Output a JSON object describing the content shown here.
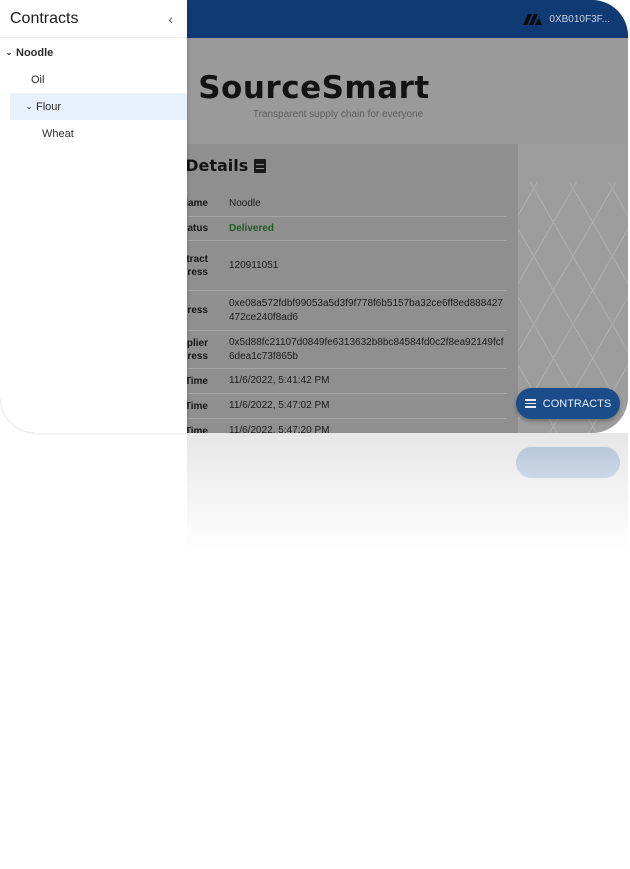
{
  "drawer": {
    "title": "Contracts",
    "tree": [
      {
        "label": "Noodle",
        "expanded": true
      },
      {
        "label": "Oil"
      },
      {
        "label": "Flour",
        "expanded": true,
        "selected": true
      },
      {
        "label": "Wheat"
      }
    ]
  },
  "header": {
    "wallet_address": "0XB010F3F...",
    "brand": "SourceSmart",
    "tagline": "Transparent supply chain for everyone"
  },
  "details": {
    "title_visible": "t Details",
    "rows": [
      {
        "key": "lame",
        "value": "Noodle"
      },
      {
        "key": "atus",
        "value": "Delivered"
      },
      {
        "key": "tract\nress",
        "value": "120911051"
      },
      {
        "key": "ress",
        "value": "0xe08a572fdbf99053a5d3f9f778f6b5157ba32ce6ff8ed888427472ce240f8ad6"
      },
      {
        "key": "plier\nress",
        "value": "0x5d88fc21107d0849fe6313632b8bc84584fd0c2f8ea92149fcf6dea1c73f865b"
      },
      {
        "key": "Time",
        "value": "11/6/2022, 5:41:42 PM"
      },
      {
        "key": "Time",
        "value": "11/6/2022, 5:47:02 PM"
      },
      {
        "key": "Time",
        "value": "11/6/2022, 5:47:20 PM"
      }
    ]
  },
  "fab": {
    "label": "CONTRACTS"
  },
  "colors": {
    "appbar": "#0f3a73",
    "fab": "#1a4c8a",
    "delivered": "#1f5e22",
    "selected_bg": "#e8f0fb"
  },
  "icons": {
    "collapse": "chevron-left-icon",
    "expand": "chevron-down-icon",
    "wallet": "wallet-logo-icon",
    "details": "document-icon",
    "fab": "list-icon"
  }
}
